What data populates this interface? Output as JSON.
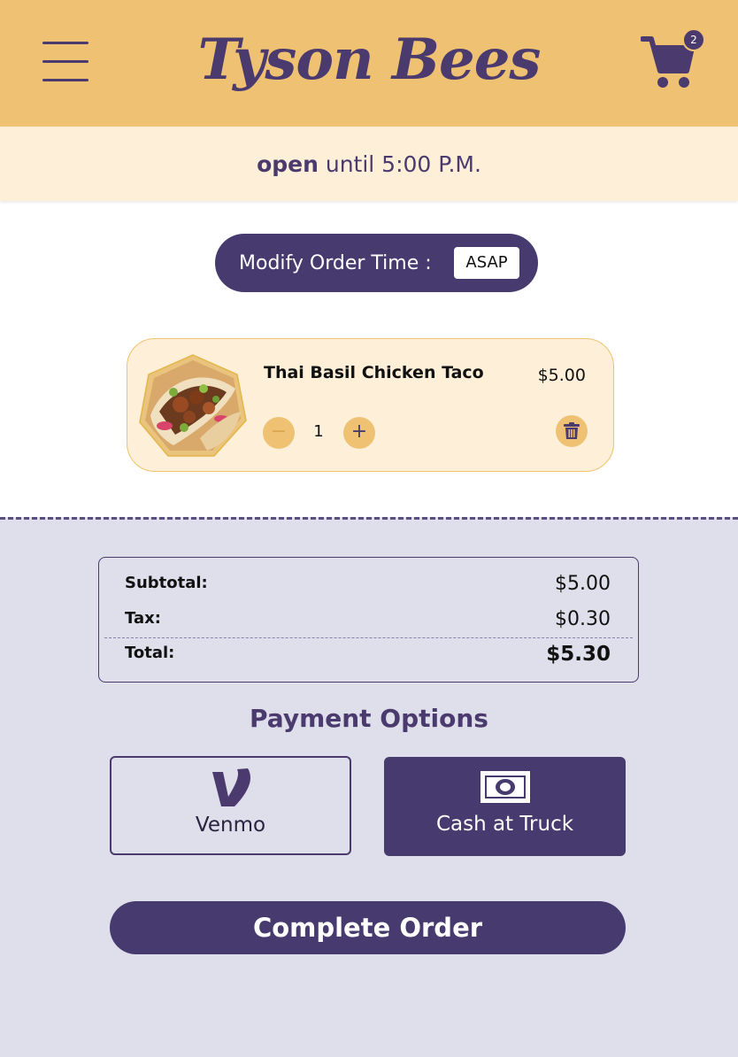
{
  "header": {
    "brand": "Tyson Bees",
    "cart_count": "2"
  },
  "status": {
    "open_word": "open",
    "until_text": " until 5:00 P.M."
  },
  "order_time": {
    "label": "Modify Order Time :",
    "value": "ASAP"
  },
  "cart_items": [
    {
      "name": "Thai Basil Chicken Taco",
      "price": "$5.00",
      "quantity": "1",
      "decrement_symbol": "−",
      "increment_symbol": "+"
    }
  ],
  "summary": {
    "subtotal_label": "Subtotal:",
    "subtotal_value": "$5.00",
    "tax_label": "Tax:",
    "tax_value": "$0.30",
    "total_label": "Total:",
    "total_value": "$5.30"
  },
  "payment": {
    "title": "Payment Options",
    "options": [
      {
        "label": "Venmo",
        "icon": "venmo-icon",
        "selected": false
      },
      {
        "label": "Cash at Truck",
        "icon": "cash-icon",
        "selected": true
      }
    ]
  },
  "complete_button": "Complete Order",
  "colors": {
    "header_bg": "#efc273",
    "brand_purple": "#463a6e",
    "cream": "#fdefd8",
    "bottom_bg": "#dfdeeb"
  }
}
